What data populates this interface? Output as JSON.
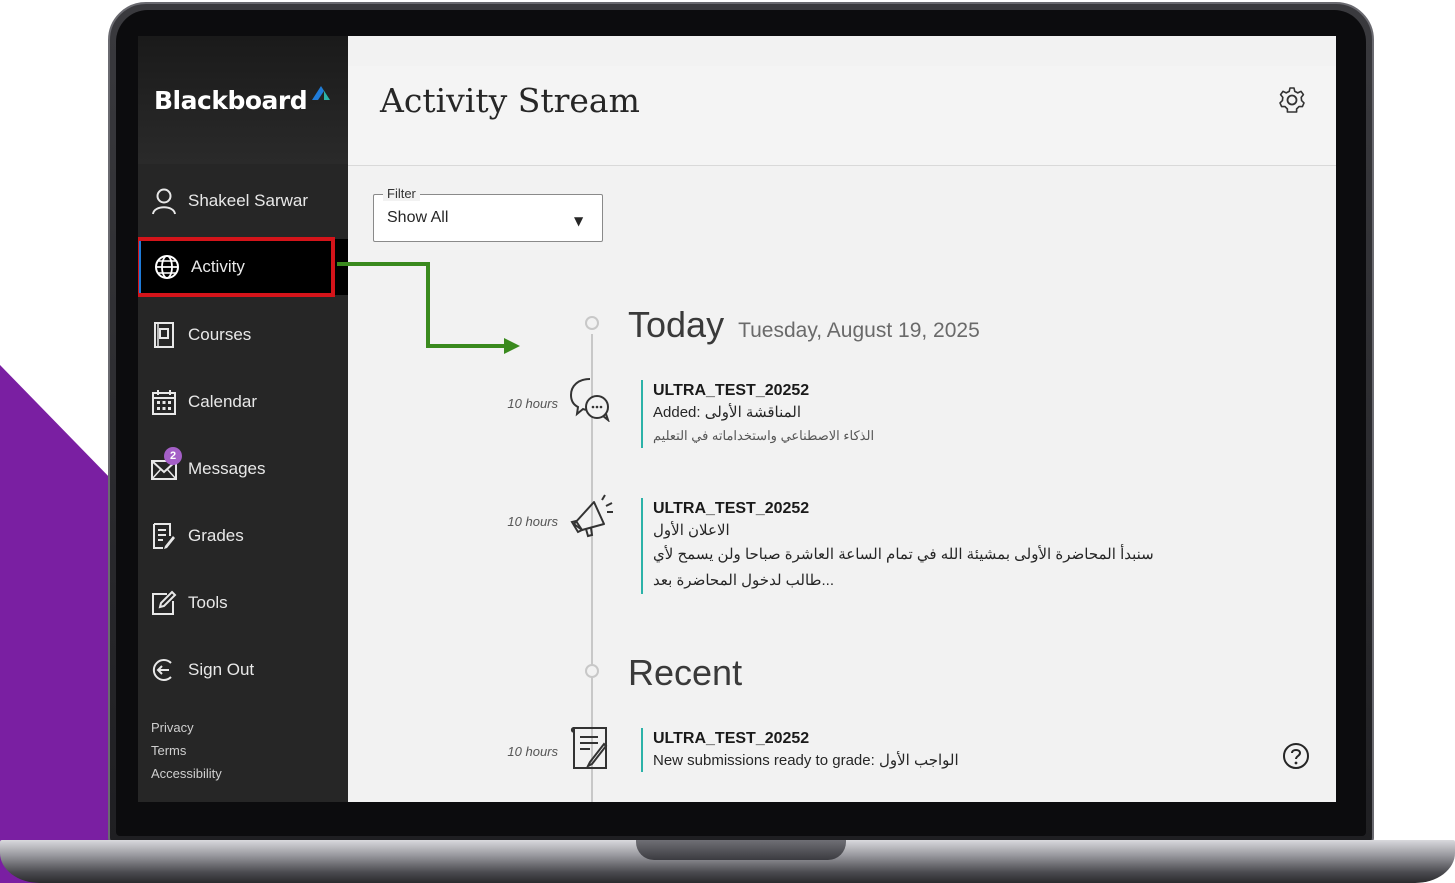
{
  "colors": {
    "sidebar_bg": "#262626",
    "accent_blue": "#1f7bd8",
    "highlight_red": "#d4141a",
    "arrow_green": "#3a8a1e",
    "purple": "#7a1fa2",
    "teal_bar": "#2bb2a8",
    "badge_purple": "#a45fc7"
  },
  "brand": {
    "name": "Blackboard"
  },
  "sidebar": {
    "user": {
      "label": "Shakeel Sarwar",
      "icon": "user-icon"
    },
    "items": [
      {
        "label": "Activity",
        "icon": "globe-icon",
        "active": true
      },
      {
        "label": "Courses",
        "icon": "book-icon"
      },
      {
        "label": "Calendar",
        "icon": "calendar-icon"
      },
      {
        "label": "Messages",
        "icon": "envelope-icon",
        "badge": "2"
      },
      {
        "label": "Grades",
        "icon": "grades-icon"
      },
      {
        "label": "Tools",
        "icon": "edit-icon"
      },
      {
        "label": "Sign Out",
        "icon": "sign-out-icon"
      }
    ],
    "footer": [
      "Privacy",
      "Terms",
      "Accessibility"
    ]
  },
  "header": {
    "title": "Activity Stream",
    "settings_icon": "gear-icon"
  },
  "filter": {
    "legend": "Filter",
    "value": "Show All"
  },
  "today": {
    "label": "Today",
    "date": "Tuesday, August 19, 2025",
    "entries": [
      {
        "time": "10 hours",
        "icon": "discussion-icon",
        "course": "ULTRA_TEST_20252",
        "line1": "Added: المناقشة الأولى",
        "line2": "الذكاء الاصطناعي واستخداماته في التعليم"
      },
      {
        "time": "10 hours",
        "icon": "announcement-icon",
        "course": "ULTRA_TEST_20252",
        "line1": "الاعلان الأول",
        "line2": "سنبدأ المحاضرة الأولى بمشيئة الله في تمام الساعة العاشرة صباحا ولن يسمح لأي",
        "line3": "...طالب لدخول المحاضرة بعد"
      }
    ]
  },
  "recent": {
    "label": "Recent",
    "entries": [
      {
        "time": "10 hours",
        "icon": "assignment-icon",
        "course": "ULTRA_TEST_20252",
        "line1": "New submissions ready to grade: الواجب الأول"
      }
    ]
  },
  "help_icon": "help-icon"
}
